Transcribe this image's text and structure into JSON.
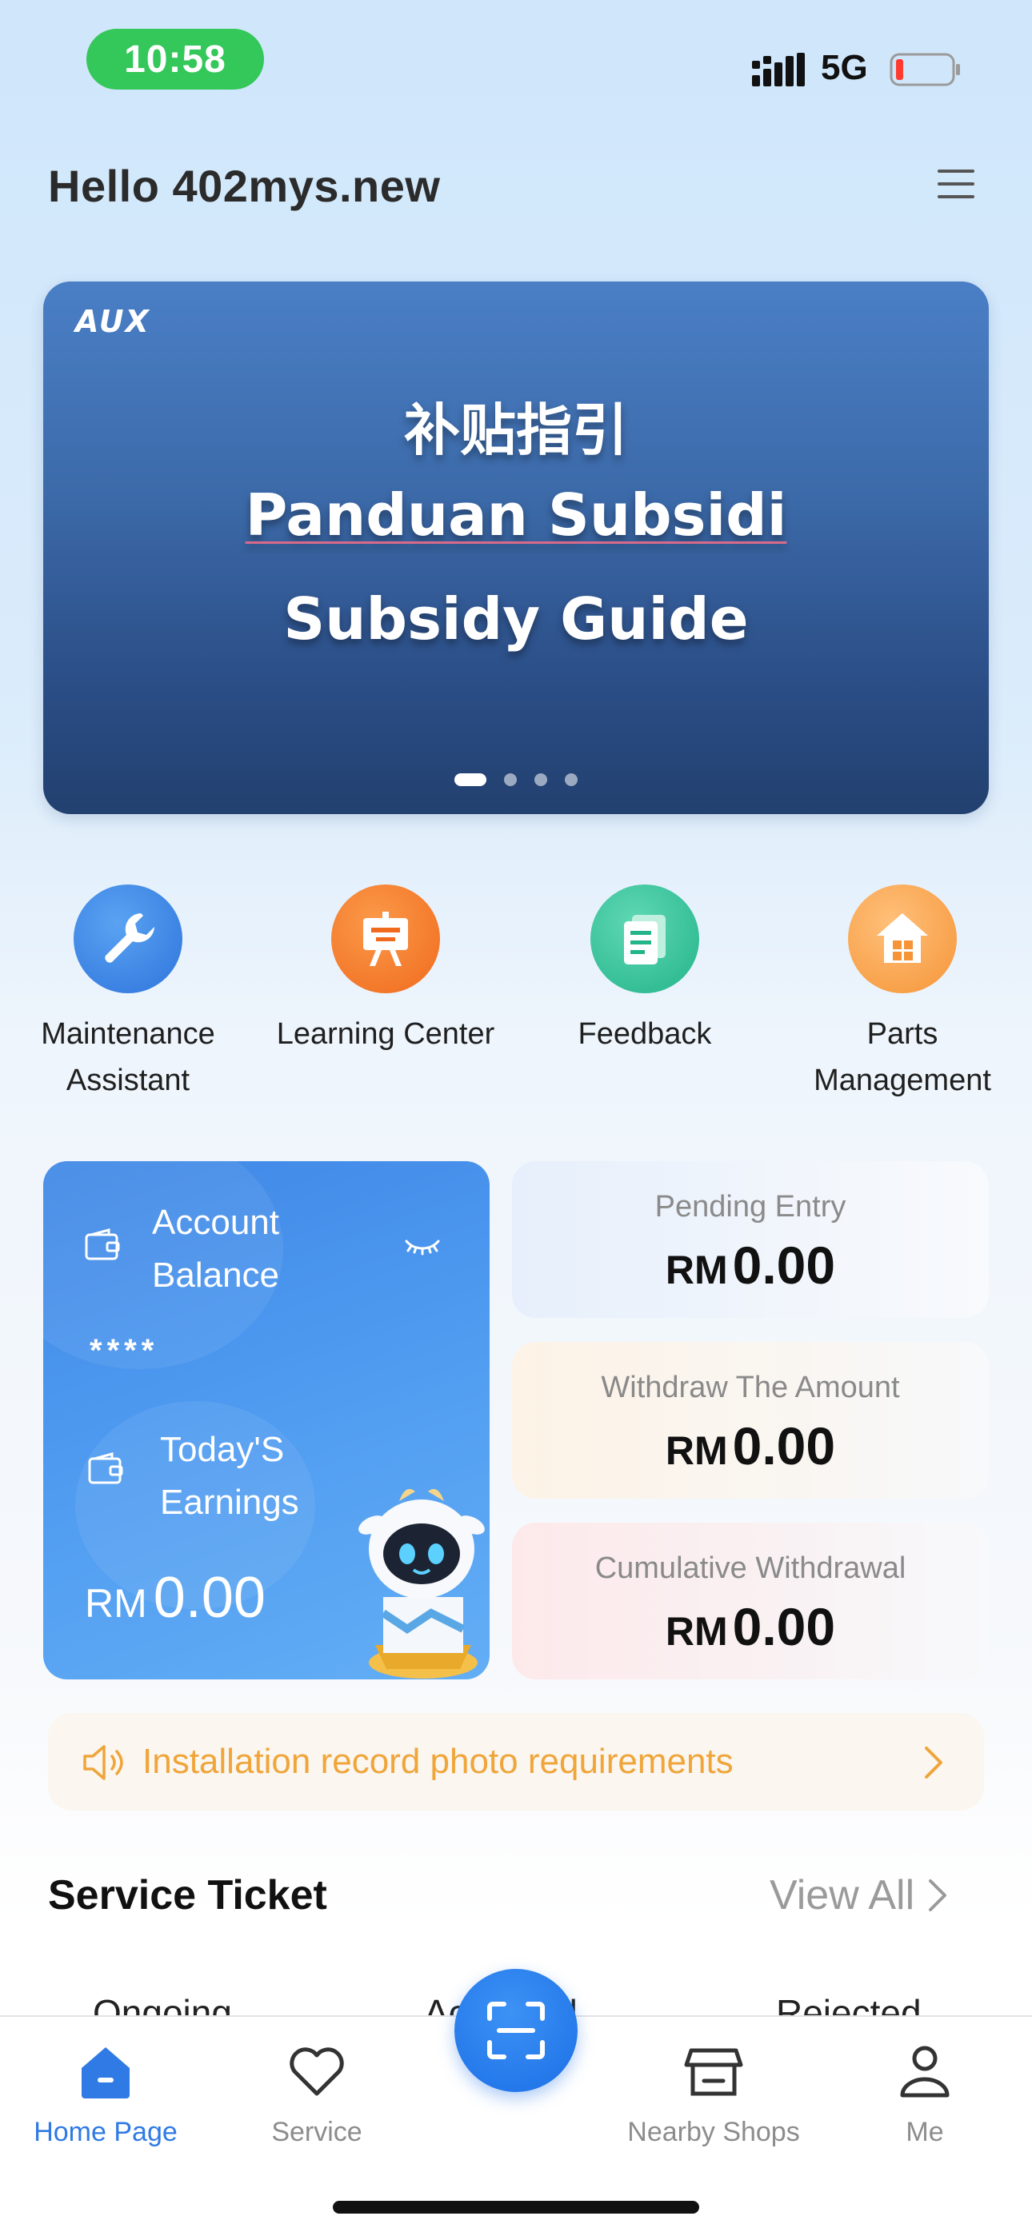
{
  "status_bar": {
    "time": "10:58",
    "network": "5G",
    "battery_level": 0.1
  },
  "header": {
    "greeting": "Hello 402mys.new"
  },
  "banner": {
    "brand": "AUX",
    "line_chinese": "补贴指引",
    "line_malay": "Panduan Subsidi",
    "line_english": "Subsidy Guide",
    "slide_count": 4,
    "active_slide": 1
  },
  "quick_actions": [
    {
      "label": "Maintenance\nAssistant",
      "icon": "wrench-icon",
      "color": "#2f74dc"
    },
    {
      "label": "Learning Center",
      "icon": "easel-icon",
      "color": "#f06a1d"
    },
    {
      "label": "Feedback",
      "icon": "documents-icon",
      "color": "#24b48a"
    },
    {
      "label": "Parts\nManagement",
      "icon": "house-box-icon",
      "color": "#f59538"
    }
  ],
  "balance_card": {
    "account_balance_label": "Account Balance",
    "account_balance_masked": "****",
    "todays_earnings_label": "Today'S Earnings",
    "currency": "RM",
    "todays_earnings_value": "0.00"
  },
  "stats": [
    {
      "label": "Pending Entry",
      "currency": "RM",
      "value": "0.00"
    },
    {
      "label": "Withdraw The Amount",
      "currency": "RM",
      "value": "0.00"
    },
    {
      "label": "Cumulative Withdrawal",
      "currency": "RM",
      "value": "0.00"
    }
  ],
  "notice": {
    "text": "Installation record photo requirements",
    "color": "#efa53a"
  },
  "service_ticket": {
    "title": "Service Ticket",
    "view_all": "View All",
    "tabs": [
      "Ongoing",
      "Accepted",
      "Rejected"
    ]
  },
  "bottom_nav": [
    {
      "label": "Home Page",
      "active": true
    },
    {
      "label": "Service",
      "active": false
    },
    {
      "label": "Nearby Shops",
      "active": false
    },
    {
      "label": "Me",
      "active": false
    }
  ],
  "colors": {
    "accent": "#2f7ae5",
    "notice": "#efa53a",
    "status_green": "#34c759"
  }
}
